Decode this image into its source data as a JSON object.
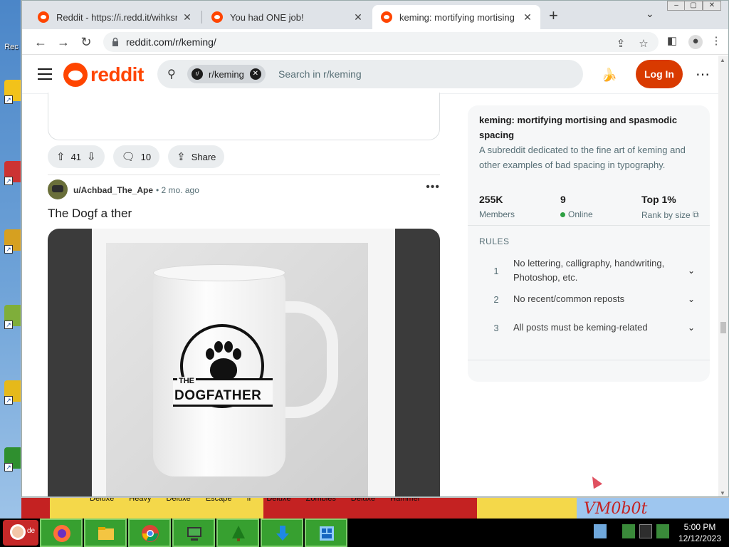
{
  "browser": {
    "tabs": [
      {
        "title": "Reddit - https://i.redd.it/wihksn0..."
      },
      {
        "title": "You had ONE job!"
      },
      {
        "title": "keming: mortifying mortising and spasmodic spacing"
      }
    ],
    "url": "reddit.com/r/keming/"
  },
  "reddit": {
    "logo_text": "reddit",
    "search_chip": "r/keming",
    "search_chip_icon": "r/",
    "search_placeholder": "Search in r/keming",
    "login_label": "Log In"
  },
  "prev_post": {
    "votes": "41",
    "comments": "10",
    "share_label": "Share"
  },
  "post": {
    "author": "u/Achbad_The_Ape",
    "age": "• 2 mo. ago",
    "title": "The Dogf a ther",
    "image_text_the": "THE",
    "image_text_brand": "DOGFATHER"
  },
  "sidebar": {
    "title": "keming: mortifying mortising and spasmodic spacing",
    "description": "A subreddit dedicated to the fine art of keming and other examples of bad spacing in typography.",
    "stats": [
      {
        "value": "255K",
        "label": "Members"
      },
      {
        "value": "9",
        "label": "Online"
      },
      {
        "value": "Top 1%",
        "label": "Rank by size"
      }
    ],
    "rules_heading": "RULES",
    "rules": [
      {
        "n": "1",
        "text": "No lettering, calligraphy, handwriting, Photoshop, etc."
      },
      {
        "n": "2",
        "text": "No recent/common reposts"
      },
      {
        "n": "3",
        "text": "All posts must be keming-related"
      }
    ]
  },
  "desktop": {
    "strip_labels": "Deluxe Heavy Deluxe Escape fr Deluxe Zombies Deluxe Hammer",
    "wallpaper_text": "VM0b0t",
    "start_label": "de"
  },
  "taskbar": {
    "time": "5:00 PM",
    "date": "12/12/2023"
  }
}
